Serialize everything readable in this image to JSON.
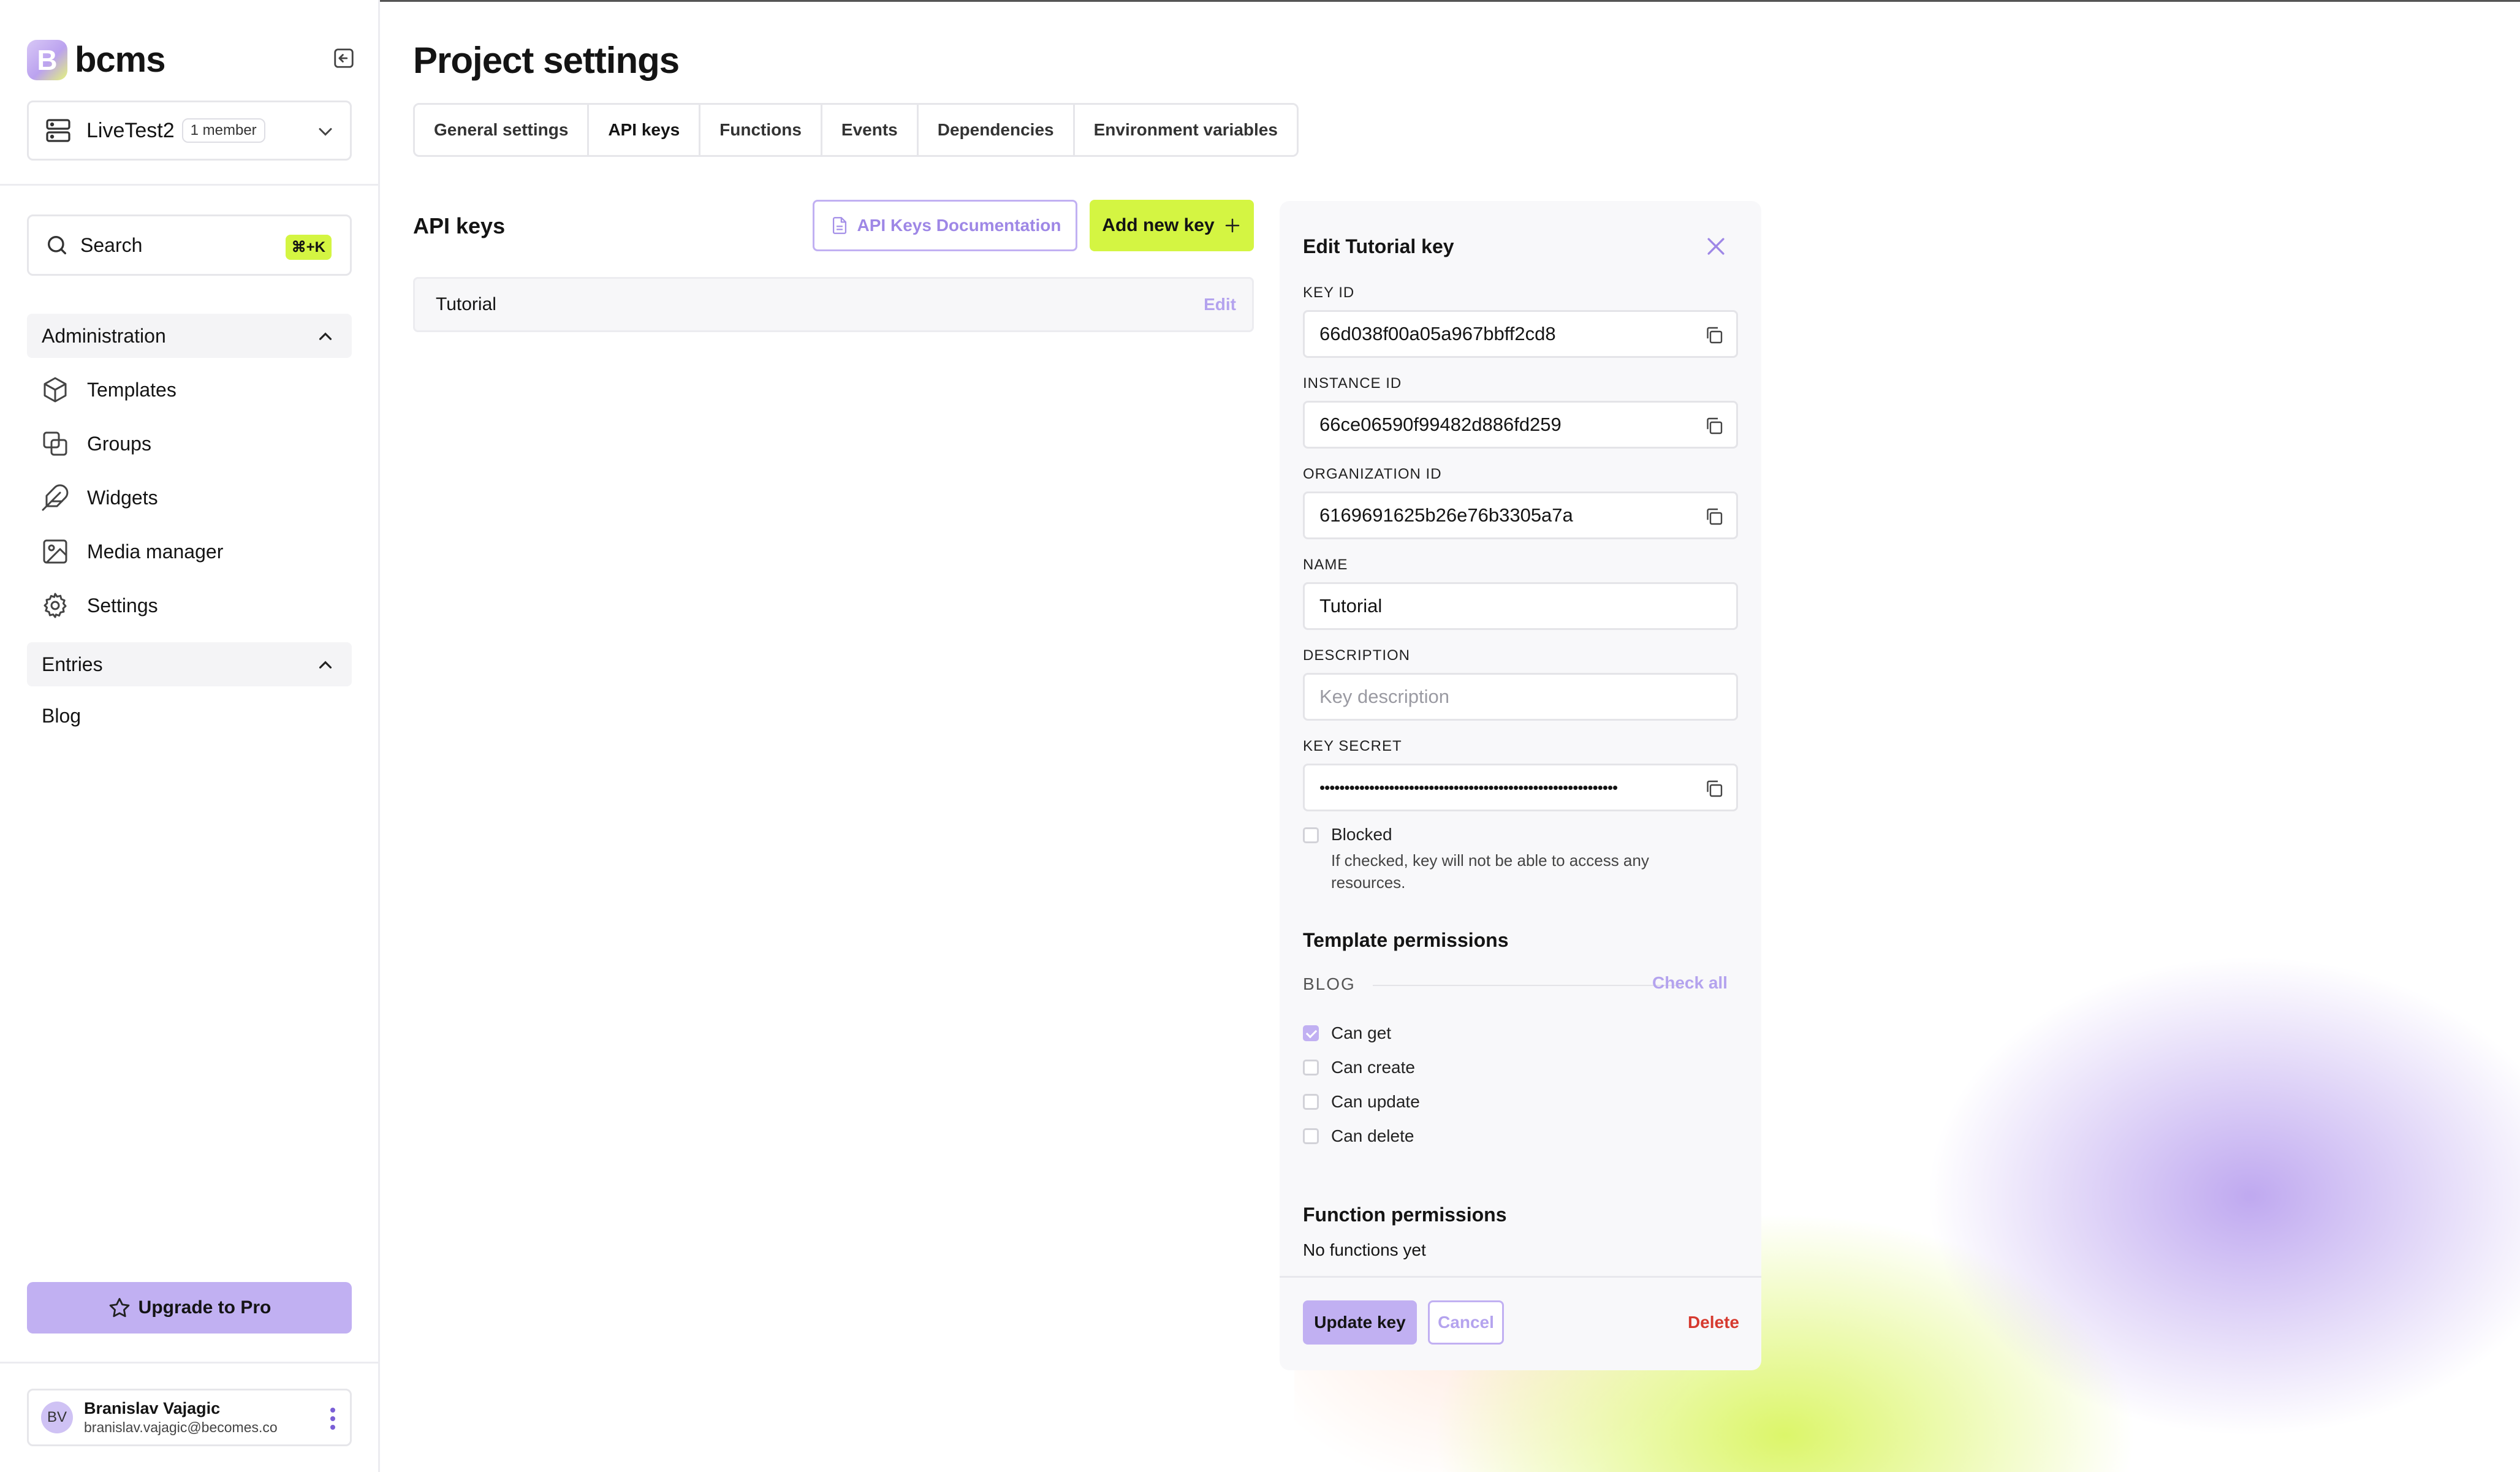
{
  "app": {
    "logo_letter": "B",
    "logo_text": "bcms"
  },
  "project": {
    "name": "LiveTest2",
    "members": "1 member"
  },
  "search": {
    "label": "Search",
    "shortcut": "⌘+K"
  },
  "sidebar": {
    "administration": {
      "label": "Administration",
      "items": [
        {
          "label": "Templates",
          "icon": "cube-icon"
        },
        {
          "label": "Groups",
          "icon": "groups-icon"
        },
        {
          "label": "Widgets",
          "icon": "feather-icon"
        },
        {
          "label": "Media manager",
          "icon": "image-icon"
        },
        {
          "label": "Settings",
          "icon": "gear-icon"
        }
      ]
    },
    "entries": {
      "label": "Entries",
      "items": [
        {
          "label": "Blog"
        }
      ]
    },
    "upgrade_label": "Upgrade to Pro",
    "user": {
      "initials": "BV",
      "name": "Branislav Vajagic",
      "email": "branislav.vajagic@becomes.co"
    }
  },
  "page": {
    "title": "Project settings",
    "tabs": [
      {
        "label": "General settings",
        "active": false
      },
      {
        "label": "API keys",
        "active": true
      },
      {
        "label": "Functions",
        "active": false
      },
      {
        "label": "Events",
        "active": false
      },
      {
        "label": "Dependencies",
        "active": false
      },
      {
        "label": "Environment variables",
        "active": false
      }
    ]
  },
  "api_keys": {
    "title": "API keys",
    "docs_button": "API Keys Documentation",
    "add_button": "Add new key",
    "list": [
      {
        "name": "Tutorial",
        "edit_label": "Edit"
      }
    ]
  },
  "edit_panel": {
    "title": "Edit Tutorial key",
    "key_id": {
      "label": "KEY ID",
      "value": "66d038f00a05a967bbff2cd8"
    },
    "instance_id": {
      "label": "INSTANCE ID",
      "value": "66ce06590f99482d886fd259"
    },
    "organization_id": {
      "label": "ORGANIZATION ID",
      "value": "6169691625b26e76b3305a7a"
    },
    "name": {
      "label": "NAME",
      "value": "Tutorial"
    },
    "description": {
      "label": "DESCRIPTION",
      "placeholder": "Key description",
      "value": ""
    },
    "key_secret": {
      "label": "KEY SECRET",
      "value": "••••••••••••••••••••••••••••••••••••••••••••••••••••••••••••"
    },
    "blocked": {
      "label": "Blocked",
      "hint": "If checked, key will not be able to access any resources.",
      "checked": false
    },
    "template_permissions": {
      "title": "Template permissions",
      "group": "BLOG",
      "check_all": "Check all",
      "perms": [
        {
          "label": "Can get",
          "checked": true
        },
        {
          "label": "Can create",
          "checked": false
        },
        {
          "label": "Can update",
          "checked": false
        },
        {
          "label": "Can delete",
          "checked": false
        }
      ]
    },
    "function_permissions": {
      "title": "Function permissions",
      "empty": "No functions yet"
    },
    "update_button": "Update key",
    "cancel_button": "Cancel",
    "delete_button": "Delete"
  },
  "colors": {
    "accent_purple": "#c1b0f2",
    "accent_lime": "#d4f542",
    "danger": "#d63a2f"
  }
}
